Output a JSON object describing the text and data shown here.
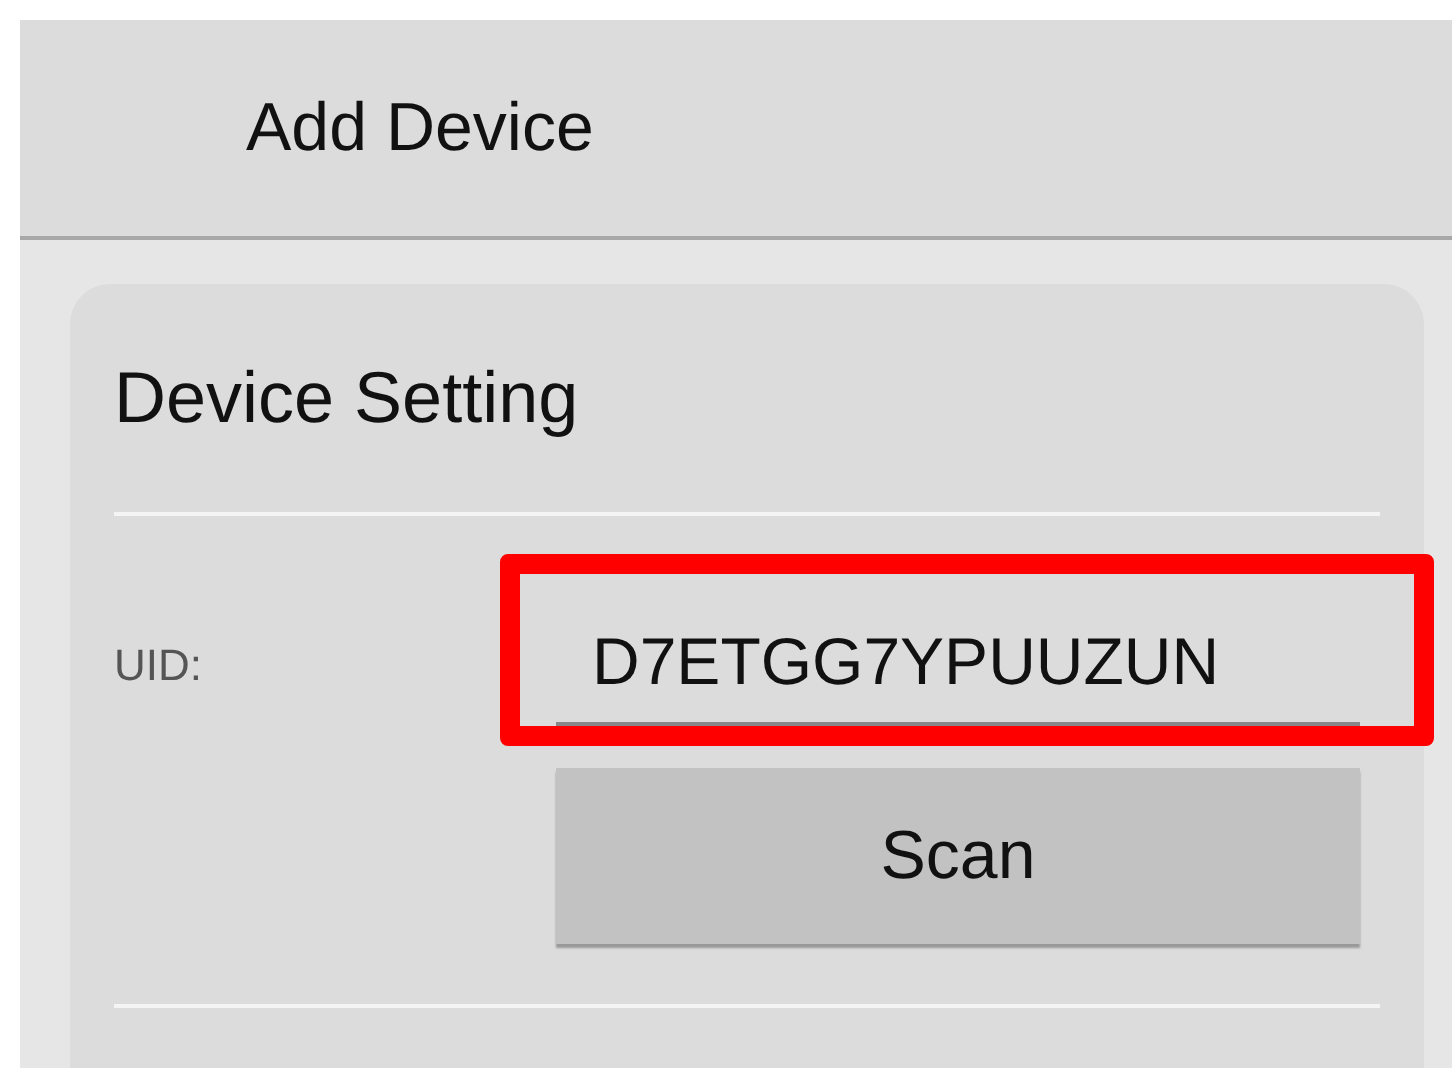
{
  "app_bar": {
    "title": "Add Device"
  },
  "card": {
    "title": "Device Setting",
    "uid": {
      "label": "UID:",
      "value": "D7ETGG7YPUUZUN",
      "highlighted": true
    },
    "scan_button": {
      "label": "Scan"
    }
  }
}
